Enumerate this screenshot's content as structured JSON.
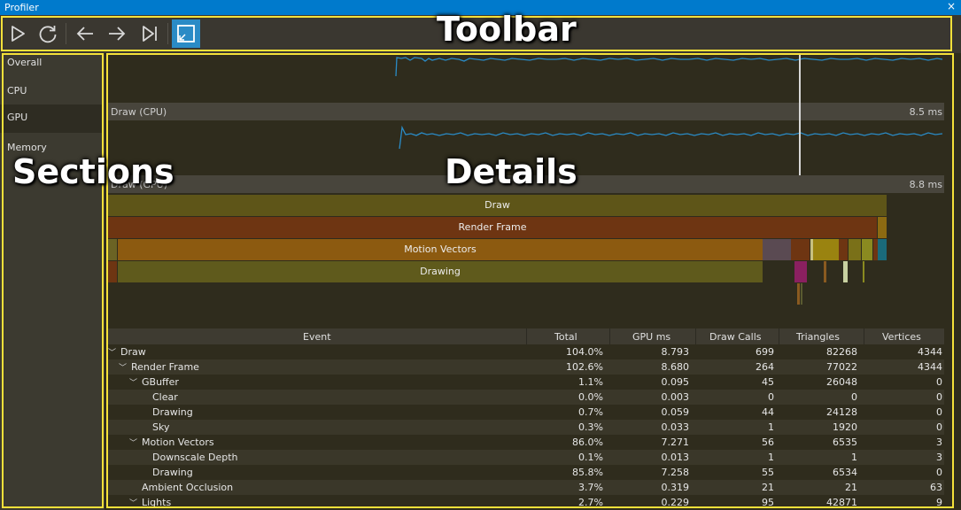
{
  "window": {
    "title": "Profiler",
    "close_glyph": "×"
  },
  "toolbar": {
    "buttons": [
      {
        "icon": "play-icon"
      },
      {
        "icon": "refresh-icon"
      },
      {
        "icon": "arrow-left-icon"
      },
      {
        "icon": "arrow-right-icon"
      },
      {
        "icon": "skip-to-end-icon"
      },
      {
        "icon": "detach-icon",
        "active": true
      }
    ]
  },
  "sections": {
    "items": [
      "Overall",
      "CPU",
      "GPU",
      "Memory"
    ],
    "selected": "GPU"
  },
  "graphs": [
    {
      "label": "Draw (CPU)",
      "value": "8.5 ms"
    },
    {
      "label": "Draw (GPU)",
      "value": "8.8 ms"
    }
  ],
  "timeline": {
    "rows": [
      {
        "label": "Draw"
      },
      {
        "label": "Render Frame"
      },
      {
        "label": "Motion Vectors"
      },
      {
        "label": "Drawing"
      }
    ]
  },
  "table": {
    "columns": [
      "Event",
      "Total",
      "GPU ms",
      "Draw Calls",
      "Triangles",
      "Vertices"
    ],
    "rows": [
      {
        "event": "Draw",
        "total": "104.0%",
        "gpu_ms": "8.793",
        "draw_calls": "699",
        "triangles": "82268",
        "vertices": "4344"
      },
      {
        "event": "Render Frame",
        "total": "102.6%",
        "gpu_ms": "8.680",
        "draw_calls": "264",
        "triangles": "77022",
        "vertices": "4344"
      },
      {
        "event": "GBuffer",
        "total": "1.1%",
        "gpu_ms": "0.095",
        "draw_calls": "45",
        "triangles": "26048",
        "vertices": "0"
      },
      {
        "event": "Clear",
        "total": "0.0%",
        "gpu_ms": "0.003",
        "draw_calls": "0",
        "triangles": "0",
        "vertices": "0"
      },
      {
        "event": "Drawing",
        "total": "0.7%",
        "gpu_ms": "0.059",
        "draw_calls": "44",
        "triangles": "24128",
        "vertices": "0"
      },
      {
        "event": "Sky",
        "total": "0.3%",
        "gpu_ms": "0.033",
        "draw_calls": "1",
        "triangles": "1920",
        "vertices": "0"
      },
      {
        "event": "Motion Vectors",
        "total": "86.0%",
        "gpu_ms": "7.271",
        "draw_calls": "56",
        "triangles": "6535",
        "vertices": "3"
      },
      {
        "event": "Downscale Depth",
        "total": "0.1%",
        "gpu_ms": "0.013",
        "draw_calls": "1",
        "triangles": "1",
        "vertices": "3"
      },
      {
        "event": "Drawing",
        "total": "85.8%",
        "gpu_ms": "7.258",
        "draw_calls": "55",
        "triangles": "6534",
        "vertices": "0"
      },
      {
        "event": "Ambient Occlusion",
        "total": "3.7%",
        "gpu_ms": "0.319",
        "draw_calls": "21",
        "triangles": "21",
        "vertices": "63"
      },
      {
        "event": "Lights",
        "total": "2.7%",
        "gpu_ms": "0.229",
        "draw_calls": "95",
        "triangles": "42871",
        "vertices": "9"
      }
    ]
  },
  "annotations": {
    "toolbar": "Toolbar",
    "sections": "Sections",
    "details": "Details"
  },
  "colors": {
    "titlebar": "#007acc",
    "highlight": "#f5e13a",
    "graph_line": "#2a8bc6",
    "draw_block": "#5e5518",
    "render_frame_block": "#6e3512",
    "motion_vectors_block": "#8c5a10",
    "drawing_block": "#5f5a1c"
  }
}
